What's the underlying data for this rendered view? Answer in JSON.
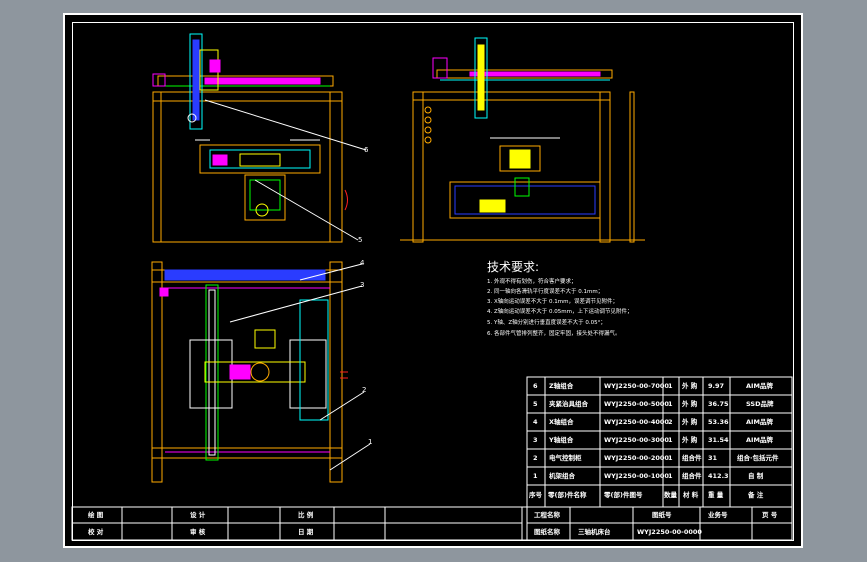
{
  "tech": {
    "title": "技术要求:",
    "notes": [
      "1. 外观不得有划伤，符合客户要求；",
      "2. 同一轴向各滑轨平行度误差不大于 0.1mm；",
      "3. X轴向运动误差不大于 0.1mm，误差调节见附件；",
      "4. Z轴向运动误差不大于 0.05mm，上下运动调节见附件；",
      "5. Y轴、Z轴分别进行垂直度误差不大于 0.05°；",
      "6. 各部件气管排列整齐，固定牢固，接头处不得漏气。"
    ]
  },
  "bom": {
    "rows": [
      {
        "no": "6",
        "name": "Z轴组合",
        "code": "WYJ2250-00-7000",
        "qty": "1",
        "mat": "外 购",
        "weight": "9.97",
        "note": "AIM品牌"
      },
      {
        "no": "5",
        "name": "夹紧治具组合",
        "code": "WYJ2250-00-5000",
        "qty": "1",
        "mat": "外 购",
        "weight": "36.75",
        "note": "SSD品牌"
      },
      {
        "no": "4",
        "name": "X轴组合",
        "code": "WYJ2250-00-4000",
        "qty": "2",
        "mat": "外 购",
        "weight": "53.36",
        "note": "AIM品牌"
      },
      {
        "no": "3",
        "name": "Y轴组合",
        "code": "WYJ2250-00-3000",
        "qty": "1",
        "mat": "外 购",
        "weight": "31.54",
        "note": "AIM品牌"
      },
      {
        "no": "2",
        "name": "电气控制柜",
        "code": "WYJ2250-00-2000",
        "qty": "1",
        "mat": "组合件",
        "weight": "31",
        "note": "组合·包括元件"
      },
      {
        "no": "1",
        "name": "机架组合",
        "code": "WYJ2250-00-1000",
        "qty": "1",
        "mat": "组合件",
        "weight": "412.3",
        "note": "自 制"
      }
    ],
    "header": {
      "no": "序号",
      "name": "零(部)件名称",
      "code": "零(部)件图号",
      "qty": "数量",
      "mat": "材 料",
      "weight": "重 量",
      "note": "备 注"
    }
  },
  "title_block": {
    "draw": "绘 图",
    "check": "校 对",
    "design": "设 计",
    "review": "审 核",
    "scale": "比 例",
    "date": "日 期",
    "project_label": "工程名称",
    "drawing_name_label": "图纸名称",
    "drawing_name": "三轴机床台",
    "drawing_no_label": "图纸号",
    "drawing_no": "WYJ2250-00-0000",
    "business_label": "业务号",
    "page_label": "页 号"
  },
  "callouts": [
    "6",
    "5",
    "4",
    "3",
    "2",
    "1"
  ],
  "colors": {
    "line": "#ffaa00",
    "magenta": "#ff00ff",
    "cyan": "#00ffff",
    "green": "#00ff00",
    "blue": "#2a3cff",
    "yellow": "#ffff00",
    "white": "#ffffff",
    "red": "#ff2020"
  }
}
